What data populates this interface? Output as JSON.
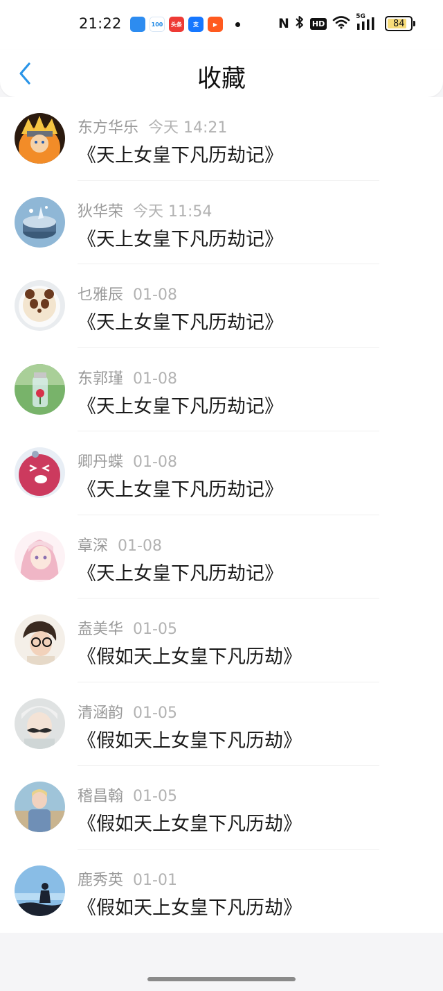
{
  "status_bar": {
    "time": "21:22",
    "app_icons": [
      {
        "name": "blue-app-icon",
        "label": "",
        "color": "#2d8cf0"
      },
      {
        "name": "100-app-icon",
        "label": "100",
        "color": "#ffffff",
        "text_color": "#1e88e5"
      },
      {
        "name": "toutiao-app-icon",
        "label": "头条",
        "color": "#ee3a35"
      },
      {
        "name": "alipay-app-icon",
        "label": "支",
        "color": "#1677ff"
      },
      {
        "name": "video-app-icon",
        "label": "▶",
        "color": "#ff5a1f"
      }
    ],
    "nfc": "N",
    "bluetooth": "✱",
    "hd": "HD",
    "wifi": "wifi",
    "network": "5G",
    "battery": "84",
    "battery_level": 84
  },
  "nav": {
    "back_icon": "chevron-left-icon",
    "title": "收藏"
  },
  "items": [
    {
      "name": "东方华乐",
      "time": "今天 14:21",
      "title": "《天上女皇下凡历劫记》",
      "avatar": "naruto",
      "avatar_colors": [
        "#f28c28",
        "#3a2a18"
      ]
    },
    {
      "name": "狄华荣",
      "time": "今天 11:54",
      "title": "《天上女皇下凡历劫记》",
      "avatar": "music-box",
      "avatar_colors": [
        "#8fb7d6",
        "#3b5a78"
      ]
    },
    {
      "name": "乜雅辰",
      "time": "01-08",
      "title": "《天上女皇下凡历劫记》",
      "avatar": "panda-latte",
      "avatar_colors": [
        "#f3e5cf",
        "#6b3a1f"
      ]
    },
    {
      "name": "东郭瑾",
      "time": "01-08",
      "title": "《天上女皇下凡历劫记》",
      "avatar": "flower-jar",
      "avatar_colors": [
        "#78b36a",
        "#d7324a"
      ]
    },
    {
      "name": "卿丹蝶",
      "time": "01-08",
      "title": "《天上女皇下凡历劫记》",
      "avatar": "pink-ball",
      "avatar_colors": [
        "#cc3a5e",
        "#e8eef5"
      ]
    },
    {
      "name": "章深",
      "time": "01-08",
      "title": "《天上女皇下凡历劫记》",
      "avatar": "anime-girl",
      "avatar_colors": [
        "#f6d6df",
        "#f0b6c6"
      ]
    },
    {
      "name": "盍美华",
      "time": "01-05",
      "title": "《假如天上女皇下凡历劫》",
      "avatar": "glasses-person",
      "avatar_colors": [
        "#f4efe8",
        "#3a2a20"
      ]
    },
    {
      "name": "清涵韵",
      "time": "01-05",
      "title": "《假如天上女皇下凡历劫》",
      "avatar": "mustache-person",
      "avatar_colors": [
        "#dfe2e2",
        "#2b2b2b"
      ]
    },
    {
      "name": "稽昌翰",
      "time": "01-05",
      "title": "《假如天上女皇下凡历劫》",
      "avatar": "beach-person",
      "avatar_colors": [
        "#9fc4d9",
        "#c9b48f"
      ]
    },
    {
      "name": "鹿秀英",
      "time": "01-01",
      "title": "《假如天上女皇下凡历劫》",
      "avatar": "sea-silhouette",
      "avatar_colors": [
        "#89bde6",
        "#1b2230"
      ]
    }
  ]
}
